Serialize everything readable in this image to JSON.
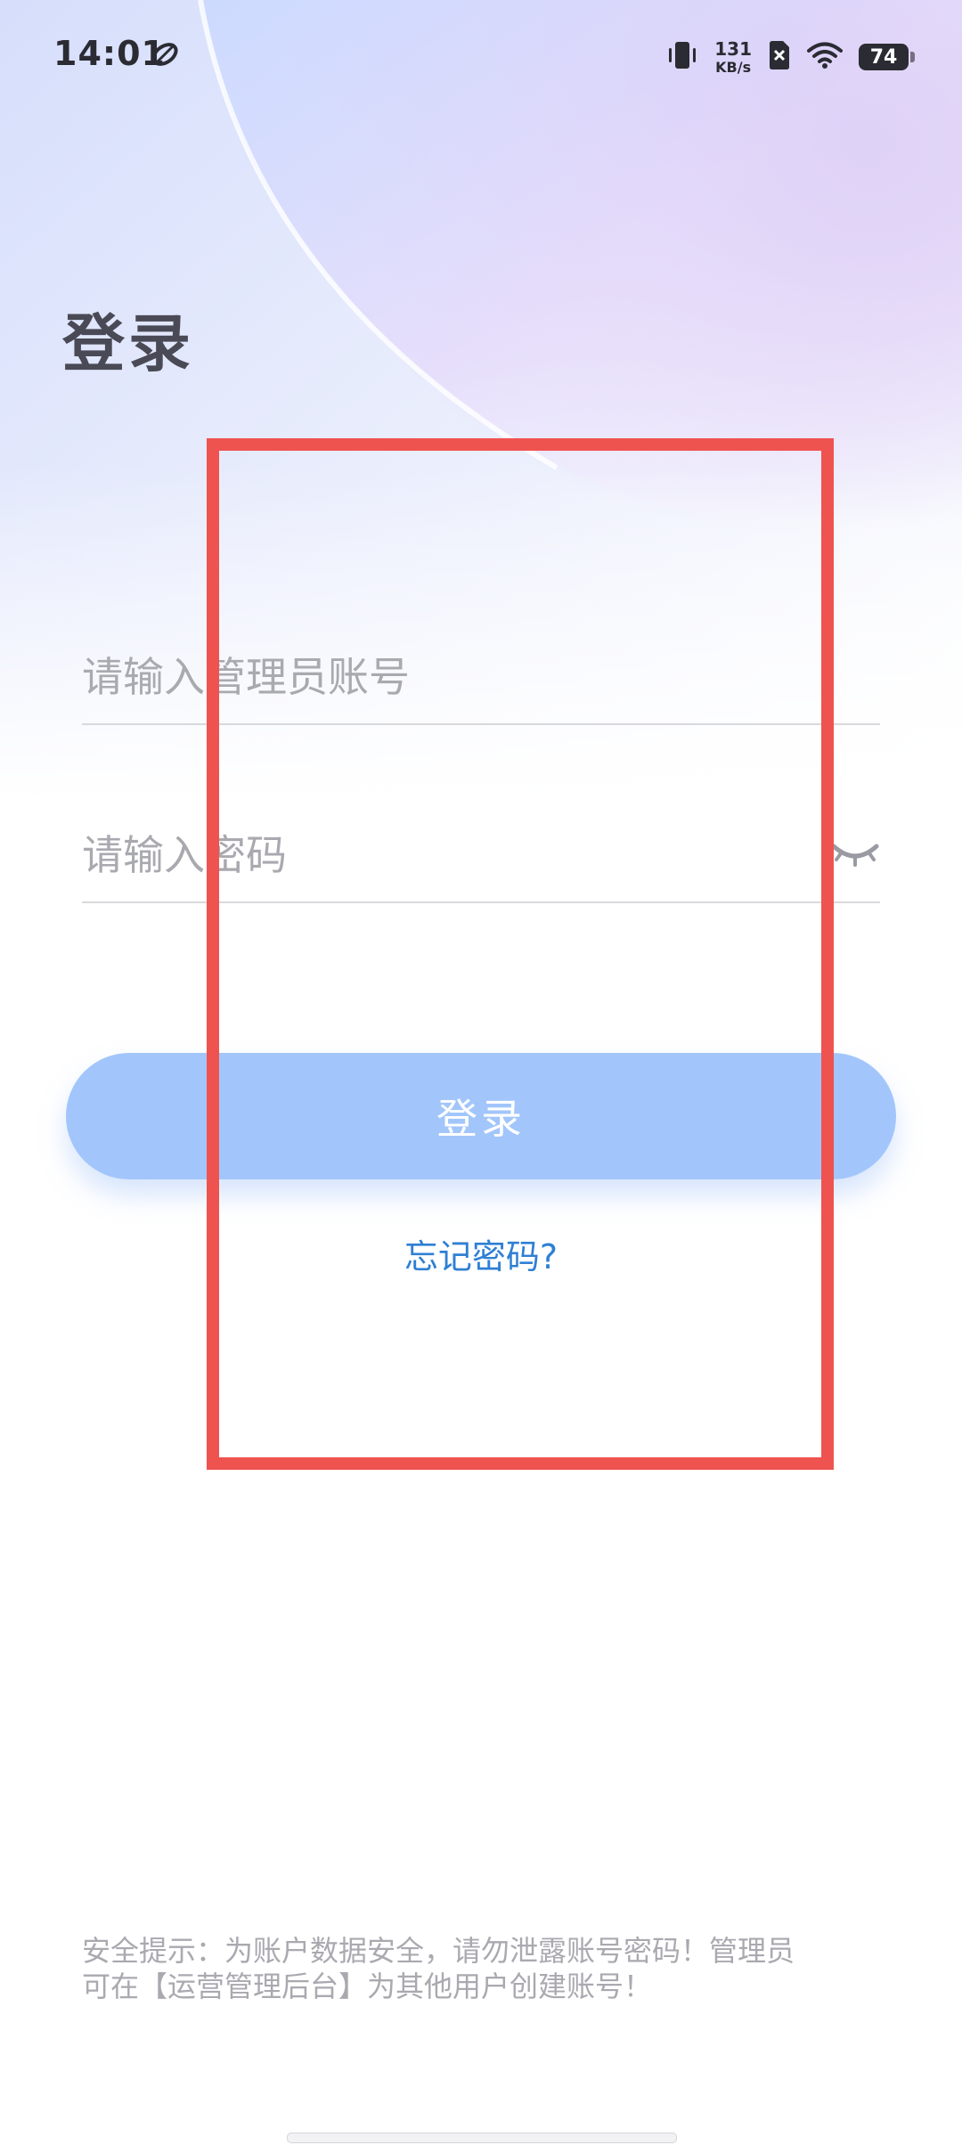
{
  "status_bar": {
    "time": "14:01",
    "net_speed_value": "131",
    "net_speed_unit": "KB/s",
    "battery_level": "74"
  },
  "login": {
    "title": "登录",
    "account_placeholder": "请输入管理员账号",
    "password_placeholder": "请输入密码",
    "submit_label": "登录",
    "forgot_password_label": "忘记密码?"
  },
  "security_tip": {
    "line1": "安全提示：为账户数据安全，请勿泄露账号密码！管理员",
    "line2": "可在【运营管理后台】为其他用户创建账号！"
  },
  "colors": {
    "primary_button": "#a2c6fb",
    "link": "#2f7fd4",
    "highlight_border": "#ef5350",
    "title_text": "#4a4a56",
    "placeholder_text": "#a9a9b0"
  },
  "icons": {
    "status_leaf": "leaf-icon",
    "vibrate": "vibrate-icon",
    "sim_disabled": "sim-disabled-icon",
    "wifi": "wifi-icon",
    "battery": "battery-icon",
    "password_toggle": "eye-closed-icon"
  }
}
